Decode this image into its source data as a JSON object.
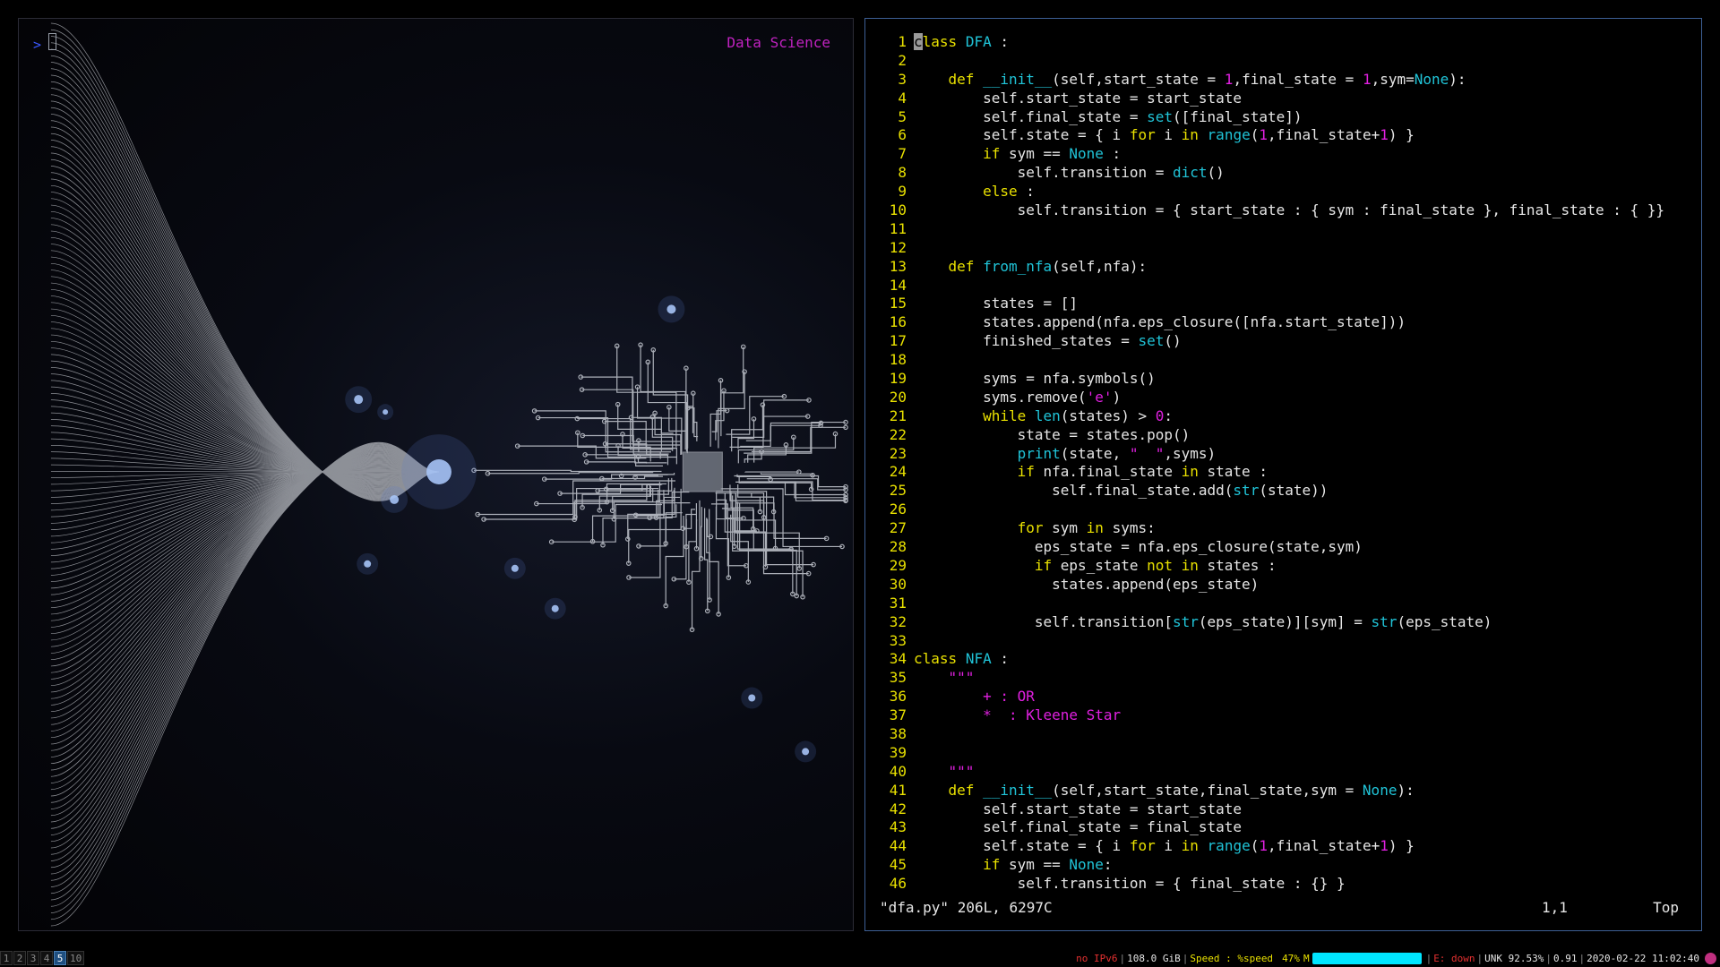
{
  "left_pane": {
    "prompt": ">",
    "title": "Data Science"
  },
  "editor": {
    "lines": [
      [
        {
          "t": "class",
          "c": "cur-first"
        },
        {
          "t": " "
        },
        {
          "t": "DFA",
          "c": "bi"
        },
        {
          "t": " :"
        }
      ],
      [],
      [
        {
          "t": "    "
        },
        {
          "t": "def",
          "c": "kw"
        },
        {
          "t": " "
        },
        {
          "t": "__init__",
          "c": "bi"
        },
        {
          "t": "(self,start_state = "
        },
        {
          "t": "1",
          "c": "num"
        },
        {
          "t": ",final_state = "
        },
        {
          "t": "1",
          "c": "num"
        },
        {
          "t": ",sym="
        },
        {
          "t": "None",
          "c": "bi"
        },
        {
          "t": "):"
        }
      ],
      [
        {
          "t": "        self.start_state = start_state"
        }
      ],
      [
        {
          "t": "        self.final_state = "
        },
        {
          "t": "set",
          "c": "bi"
        },
        {
          "t": "([final_state])"
        }
      ],
      [
        {
          "t": "        self.state = { i "
        },
        {
          "t": "for",
          "c": "kw"
        },
        {
          "t": " i "
        },
        {
          "t": "in",
          "c": "kw"
        },
        {
          "t": " "
        },
        {
          "t": "range",
          "c": "bi"
        },
        {
          "t": "("
        },
        {
          "t": "1",
          "c": "num"
        },
        {
          "t": ",final_state+"
        },
        {
          "t": "1",
          "c": "num"
        },
        {
          "t": ") }"
        }
      ],
      [
        {
          "t": "        "
        },
        {
          "t": "if",
          "c": "kw"
        },
        {
          "t": " sym == "
        },
        {
          "t": "None",
          "c": "bi"
        },
        {
          "t": " :"
        }
      ],
      [
        {
          "t": "            self.transition = "
        },
        {
          "t": "dict",
          "c": "bi"
        },
        {
          "t": "()"
        }
      ],
      [
        {
          "t": "        "
        },
        {
          "t": "else",
          "c": "kw"
        },
        {
          "t": " :"
        }
      ],
      [
        {
          "t": "            self.transition = { start_state : { sym : final_state }, final_state : { }}"
        }
      ],
      [],
      [],
      [
        {
          "t": "    "
        },
        {
          "t": "def",
          "c": "kw"
        },
        {
          "t": " "
        },
        {
          "t": "from_nfa",
          "c": "bi"
        },
        {
          "t": "(self,nfa):"
        }
      ],
      [],
      [
        {
          "t": "        states = []"
        }
      ],
      [
        {
          "t": "        states.append(nfa.eps_closure([nfa.start_state]))"
        }
      ],
      [
        {
          "t": "        finished_states = "
        },
        {
          "t": "set",
          "c": "bi"
        },
        {
          "t": "()"
        }
      ],
      [],
      [
        {
          "t": "        syms = nfa.symbols()"
        }
      ],
      [
        {
          "t": "        syms.remove("
        },
        {
          "t": "'e'",
          "c": "str"
        },
        {
          "t": ")"
        }
      ],
      [
        {
          "t": "        "
        },
        {
          "t": "while",
          "c": "kw"
        },
        {
          "t": " "
        },
        {
          "t": "len",
          "c": "bi"
        },
        {
          "t": "(states) > "
        },
        {
          "t": "0",
          "c": "num"
        },
        {
          "t": ":"
        }
      ],
      [
        {
          "t": "            state = states.pop()"
        }
      ],
      [
        {
          "t": "            "
        },
        {
          "t": "print",
          "c": "bi"
        },
        {
          "t": "(state, "
        },
        {
          "t": "\"  \"",
          "c": "str"
        },
        {
          "t": ",syms)"
        }
      ],
      [
        {
          "t": "            "
        },
        {
          "t": "if",
          "c": "kw"
        },
        {
          "t": " nfa.final_state "
        },
        {
          "t": "in",
          "c": "kw"
        },
        {
          "t": " state :"
        }
      ],
      [
        {
          "t": "                self.final_state.add("
        },
        {
          "t": "str",
          "c": "bi"
        },
        {
          "t": "(state))"
        }
      ],
      [],
      [
        {
          "t": "            "
        },
        {
          "t": "for",
          "c": "kw"
        },
        {
          "t": " sym "
        },
        {
          "t": "in",
          "c": "kw"
        },
        {
          "t": " syms:"
        }
      ],
      [
        {
          "t": "              eps_state = nfa.eps_closure(state,sym)"
        }
      ],
      [
        {
          "t": "              "
        },
        {
          "t": "if",
          "c": "kw"
        },
        {
          "t": " eps_state "
        },
        {
          "t": "not",
          "c": "kw"
        },
        {
          "t": " "
        },
        {
          "t": "in",
          "c": "kw"
        },
        {
          "t": " states :"
        }
      ],
      [
        {
          "t": "                states.append(eps_state)"
        }
      ],
      [],
      [
        {
          "t": "              self.transition["
        },
        {
          "t": "str",
          "c": "bi"
        },
        {
          "t": "(eps_state)][sym] = "
        },
        {
          "t": "str",
          "c": "bi"
        },
        {
          "t": "(eps_state)"
        }
      ],
      [],
      [
        {
          "t": "class",
          "c": "kw"
        },
        {
          "t": " "
        },
        {
          "t": "NFA",
          "c": "bi"
        },
        {
          "t": " :"
        }
      ],
      [
        {
          "t": "    "
        },
        {
          "t": "\"\"\"",
          "c": "str"
        }
      ],
      [
        {
          "t": "        + : OR",
          "c": "str"
        }
      ],
      [
        {
          "t": "        *  : Kleene Star",
          "c": "str"
        }
      ],
      [],
      [],
      [
        {
          "t": "    "
        },
        {
          "t": "\"\"\"",
          "c": "str"
        }
      ],
      [
        {
          "t": "    "
        },
        {
          "t": "def",
          "c": "kw"
        },
        {
          "t": " "
        },
        {
          "t": "__init__",
          "c": "bi"
        },
        {
          "t": "(self,start_state,final_state,sym = "
        },
        {
          "t": "None",
          "c": "bi"
        },
        {
          "t": "):"
        }
      ],
      [
        {
          "t": "        self.start_state = start_state"
        }
      ],
      [
        {
          "t": "        self.final_state = final_state"
        }
      ],
      [
        {
          "t": "        self.state = { i "
        },
        {
          "t": "for",
          "c": "kw"
        },
        {
          "t": " i "
        },
        {
          "t": "in",
          "c": "kw"
        },
        {
          "t": " "
        },
        {
          "t": "range",
          "c": "bi"
        },
        {
          "t": "("
        },
        {
          "t": "1",
          "c": "num"
        },
        {
          "t": ",final_state+"
        },
        {
          "t": "1",
          "c": "num"
        },
        {
          "t": ") }"
        }
      ],
      [
        {
          "t": "        "
        },
        {
          "t": "if",
          "c": "kw"
        },
        {
          "t": " sym == "
        },
        {
          "t": "None",
          "c": "bi"
        },
        {
          "t": ":"
        }
      ],
      [
        {
          "t": "            self.transition = { final_state : {} }"
        }
      ]
    ],
    "status_file": "\"dfa.py\" 206L, 6297C",
    "status_position": "1,1",
    "status_scroll": "Top"
  },
  "bottom_bar": {
    "workspaces": [
      {
        "label": "1",
        "active": false
      },
      {
        "label": "2",
        "active": false
      },
      {
        "label": "3",
        "active": false
      },
      {
        "label": "4",
        "active": false
      },
      {
        "label": "5",
        "active": true
      },
      {
        "label": "10",
        "active": false
      }
    ],
    "ipv6": "no IPv6",
    "disk": "108.0 GiB",
    "speed_label": "Speed : %speed",
    "speed_percent": "47%",
    "speed_fraction": 0.47,
    "speed_suffix": "M",
    "ethernet": "E: down",
    "battery": "UNK 92.53%",
    "load": "0.91",
    "datetime": "2020-02-22 11:02:40",
    "colors": {
      "accent": "#00e5ff",
      "alert": "#e43030",
      "speed": "#e8e000",
      "workspace_active": "#1f4f80"
    }
  }
}
